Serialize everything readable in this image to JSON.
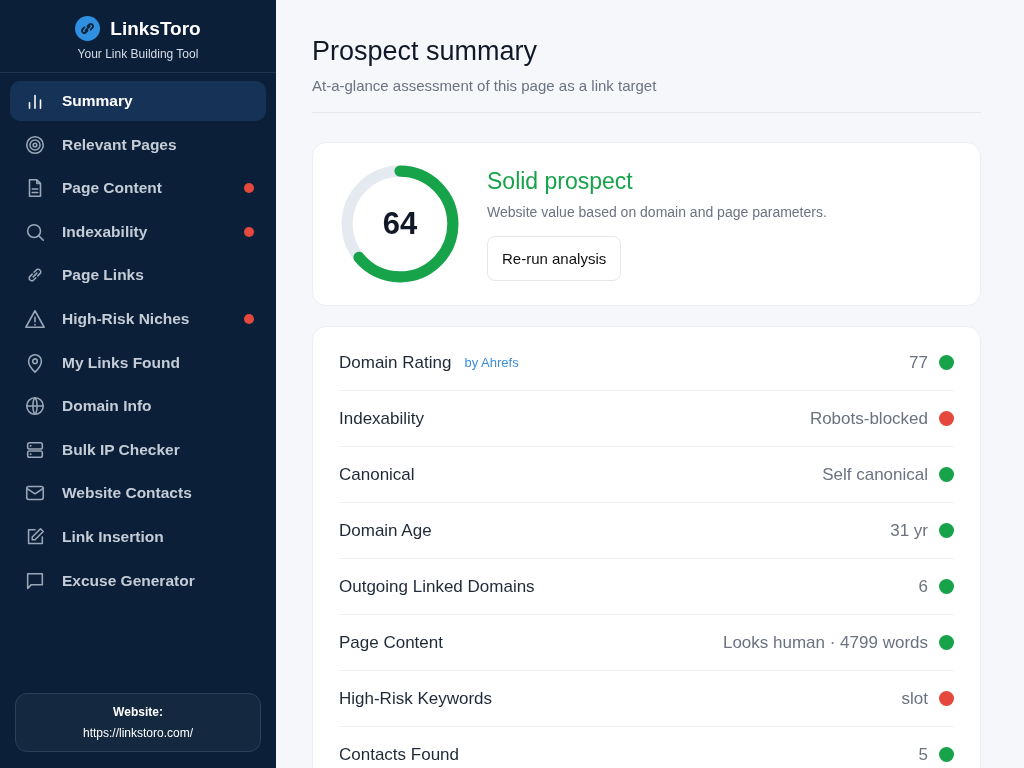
{
  "brand": {
    "name": "LinksToro",
    "tagline": "Your Link Building Tool"
  },
  "nav": [
    {
      "label": "Summary",
      "selected": true,
      "flagged": false
    },
    {
      "label": "Relevant Pages",
      "selected": false,
      "flagged": false
    },
    {
      "label": "Page Content",
      "selected": false,
      "flagged": true
    },
    {
      "label": "Indexability",
      "selected": false,
      "flagged": true
    },
    {
      "label": "Page Links",
      "selected": false,
      "flagged": false
    },
    {
      "label": "High-Risk Niches",
      "selected": false,
      "flagged": true
    },
    {
      "label": "My Links Found",
      "selected": false,
      "flagged": false
    },
    {
      "label": "Domain Info",
      "selected": false,
      "flagged": false
    },
    {
      "label": "Bulk IP Checker",
      "selected": false,
      "flagged": false
    },
    {
      "label": "Website Contacts",
      "selected": false,
      "flagged": false
    },
    {
      "label": "Link Insertion",
      "selected": false,
      "flagged": false
    },
    {
      "label": "Excuse Generator",
      "selected": false,
      "flagged": false
    }
  ],
  "website": {
    "label": "Website:",
    "url": "https://linkstoro.com/"
  },
  "header": {
    "title": "Prospect summary",
    "subtitle": "At-a-glance assessment of this page as a link target"
  },
  "score": {
    "value": "64",
    "level": 0.64,
    "verdict": "Solid prospect",
    "description": "Website value based on domain and page parameters.",
    "button": "Re-run analysis"
  },
  "metrics": [
    {
      "label": "Domain Rating",
      "source": "by Ahrefs",
      "value": "77",
      "color": "#16a34a"
    },
    {
      "label": "Indexability",
      "value": "Robots-blocked",
      "color": "#e5483d"
    },
    {
      "label": "Canonical",
      "value": "Self canonical",
      "color": "#16a34a"
    },
    {
      "label": "Domain Age",
      "value": "31 yr",
      "color": "#16a34a"
    },
    {
      "label": "Outgoing Linked Domains",
      "value": "6",
      "color": "#16a34a"
    },
    {
      "label": "Page Content",
      "value": "Looks human · 4799 words",
      "color": "#16a34a"
    },
    {
      "label": "High-Risk Keywords",
      "value": "slot",
      "color": "#e5483d"
    },
    {
      "label": "Contacts Found",
      "value": "5",
      "color": "#16a34a"
    }
  ]
}
